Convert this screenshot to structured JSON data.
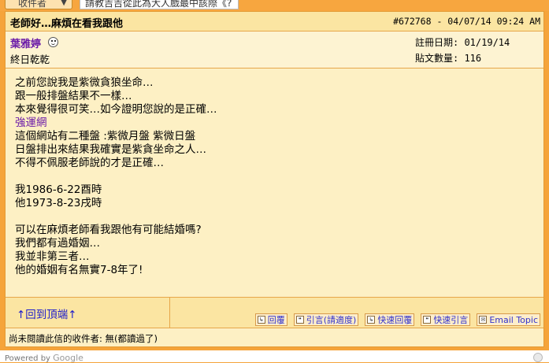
{
  "top": {
    "recipient_select": "收件者",
    "search_value": "請教吉吉從此為大人戲最中該際《?"
  },
  "post": {
    "title": "老師好…麻煩在看我跟他",
    "meta": "#672768 - 04/07/14 09:24 AM",
    "author": "葉雅婷",
    "status": "終日乾乾",
    "register_label": "註冊日期: 01/19/14",
    "post_count_label": "貼文數量: 116",
    "body_lines": [
      {
        "text": "之前您說我是紫微貪狼坐命…",
        "link": false
      },
      {
        "text": "跟一般排盤結果不一樣…",
        "link": false
      },
      {
        "text": "本來覺得很可笑…如今證明您說的是正確…",
        "link": false
      },
      {
        "text": "強運網",
        "link": true
      },
      {
        "text": "這個網站有二種盤 :紫微月盤 紫微日盤",
        "link": false
      },
      {
        "text": "日盤排出來結果我確實是紫貪坐命之人…",
        "link": false
      },
      {
        "text": "不得不佩服老師說的才是正確…",
        "link": false
      },
      {
        "text": "",
        "link": false
      },
      {
        "text": "我1986-6-22酉時",
        "link": false
      },
      {
        "text": "他1973-8-23戌時",
        "link": false
      },
      {
        "text": "",
        "link": false
      },
      {
        "text": "可以在麻煩老師看我跟他有可能結婚嗎?",
        "link": false
      },
      {
        "text": "我們都有過婚姻…",
        "link": false
      },
      {
        "text": "我並非第三者…",
        "link": false
      },
      {
        "text": "他的婚姻有名無實7-8年了!",
        "link": false
      }
    ]
  },
  "footer": {
    "back_to_top": "↑回到頂端↑",
    "actions": [
      {
        "label": "回覆",
        "icon": "reply-icon"
      },
      {
        "label": "引言(請適度)",
        "icon": "quote-icon"
      },
      {
        "label": "快速回覆",
        "icon": "quick-reply-icon"
      },
      {
        "label": "快速引言",
        "icon": "quick-quote-icon"
      },
      {
        "label": "Email Topic",
        "icon": "email-icon"
      }
    ],
    "unread_note": "尚未閱讀此信的收件者: 無(都讀過了)"
  },
  "google": {
    "powered_by": "Powered by",
    "brand": "Google"
  }
}
